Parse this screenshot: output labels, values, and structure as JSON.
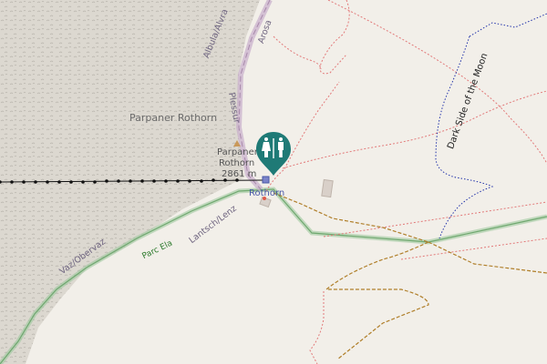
{
  "map": {
    "summit_label": "Parpaner Rothorn",
    "peak_name_lines": [
      "Parpaner",
      "Rothorn"
    ],
    "peak_elevation": "2861 m",
    "station_label": "Rothorn",
    "road_labels": {
      "albula": "Albula/Alvra",
      "plessur": "Plessur",
      "arosa": "Arosa",
      "lantsch": "Lantsch/Lenz",
      "vaz": "Vaz/Obervaz",
      "parc": "Parc Ela"
    },
    "trail_label": "Dark Side of the Moon",
    "toilet_marker_icon": "toilets-icon",
    "peak_icon": "peak-triangle-icon",
    "colors": {
      "background": "#f2efe9",
      "rock": "#d4d0c8",
      "boundary": "#c6a6c6",
      "park_green": "#8fc08f",
      "marker": "#1f7a76",
      "aerialway": "#111111",
      "path": "#b07f2a",
      "trail_blue": "#2233aa",
      "red_path": "#e07070"
    }
  }
}
